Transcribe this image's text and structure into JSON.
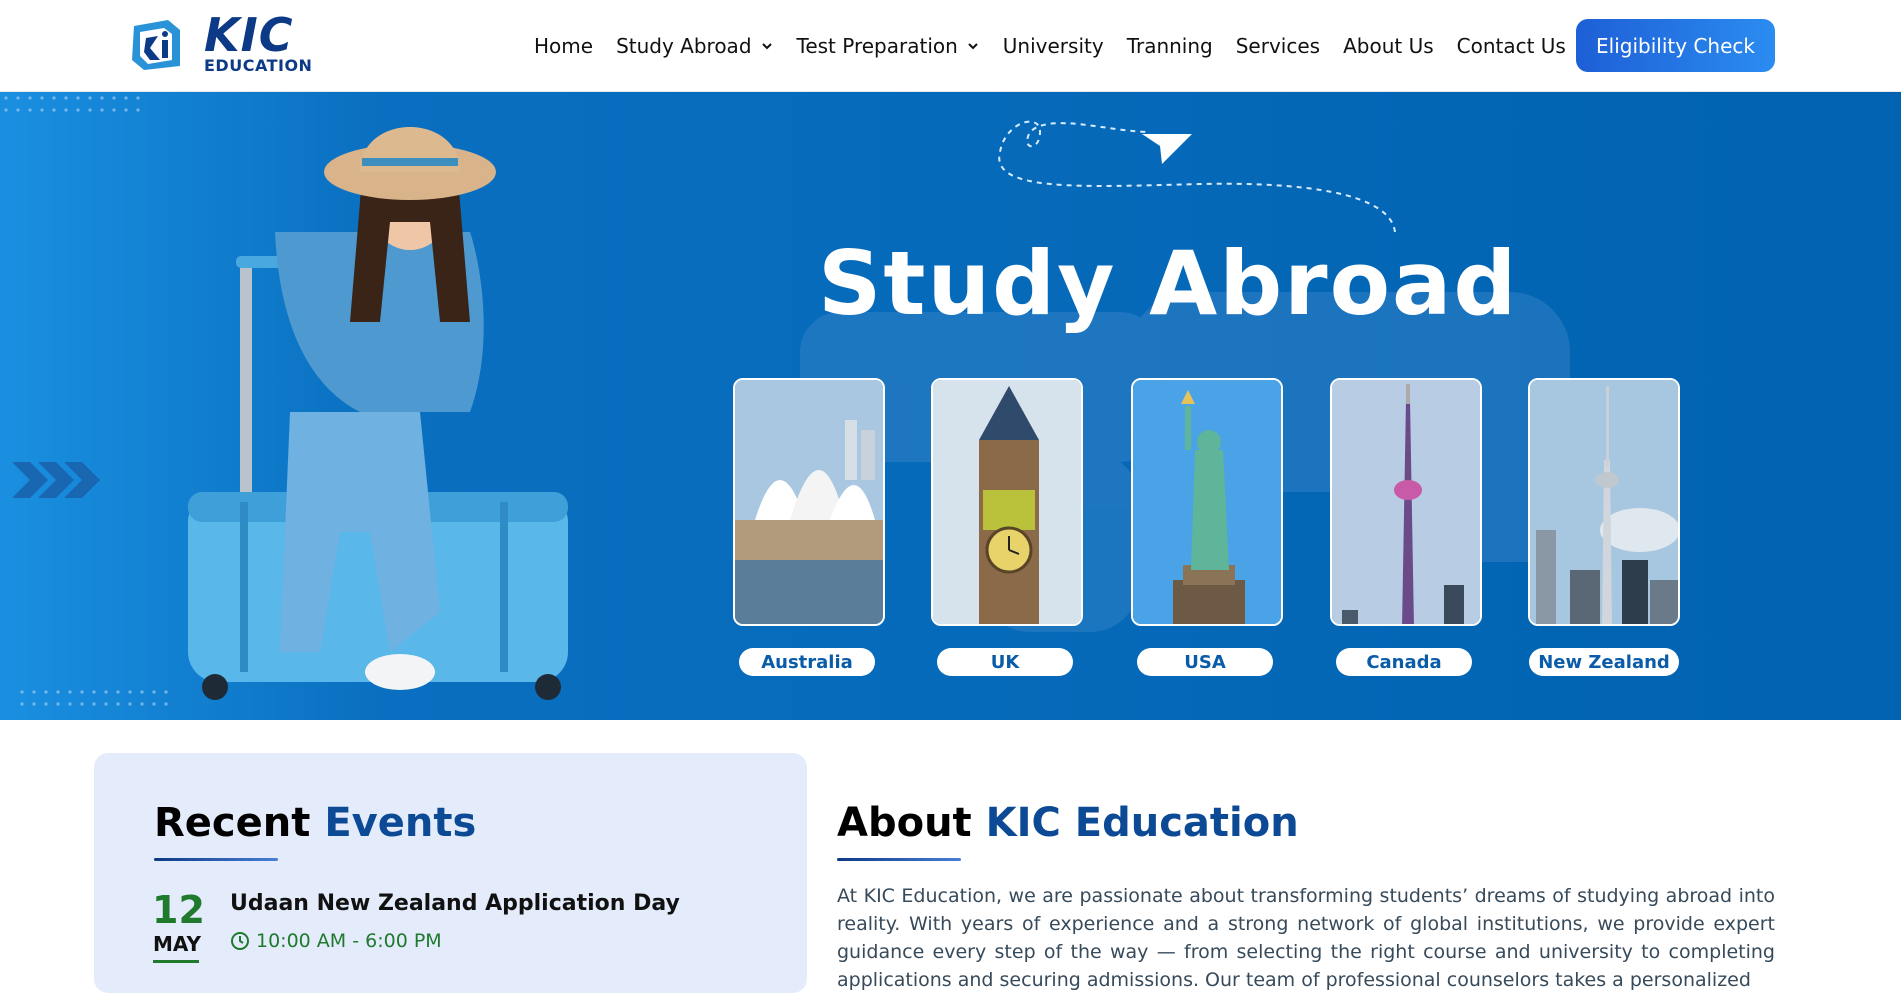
{
  "brand": {
    "name": "KIC",
    "subtitle": "EDUCATION",
    "logo_icon": "kic-logo-icon"
  },
  "nav": {
    "items": [
      {
        "label": "Home",
        "has_dropdown": false
      },
      {
        "label": "Study Abroad",
        "has_dropdown": true
      },
      {
        "label": "Test Preparation",
        "has_dropdown": true
      },
      {
        "label": "University",
        "has_dropdown": false
      },
      {
        "label": "Tranning",
        "has_dropdown": false
      },
      {
        "label": "Services",
        "has_dropdown": false
      },
      {
        "label": "About Us",
        "has_dropdown": false
      },
      {
        "label": "Contact Us",
        "has_dropdown": false
      }
    ],
    "cta_label": "Eligibility Check"
  },
  "hero": {
    "title": "Study Abroad",
    "countries": [
      {
        "label": "Australia",
        "icon": "sydney-opera-house-image"
      },
      {
        "label": "UK",
        "icon": "big-ben-image"
      },
      {
        "label": "USA",
        "icon": "statue-of-liberty-image"
      },
      {
        "label": "Canada",
        "icon": "cn-tower-image"
      },
      {
        "label": "New Zealand",
        "icon": "sky-tower-image"
      }
    ]
  },
  "events": {
    "heading_a": "Recent",
    "heading_b": "Events",
    "items": [
      {
        "day": "12",
        "month": "MAY",
        "title": "Udaan New Zealand Application Day",
        "time": "10:00 AM - 6:00 PM"
      }
    ]
  },
  "about": {
    "heading_a": "About",
    "heading_b": "KIC Education",
    "text": "At KIC Education, we are passionate about transforming students’ dreams of studying abroad into reality. With years of experience and a strong network of global institutions, we provide expert guidance every step of the way — from selecting the right course and university to completing applications and securing admissions. Our team of professional counselors takes a personalized"
  },
  "colors": {
    "primary": "#0d3a86",
    "hero_bg": "#0062b0",
    "accent_green": "#1f7a2e",
    "cta": "#1e5fd6",
    "events_bg": "#e4ecfb"
  }
}
